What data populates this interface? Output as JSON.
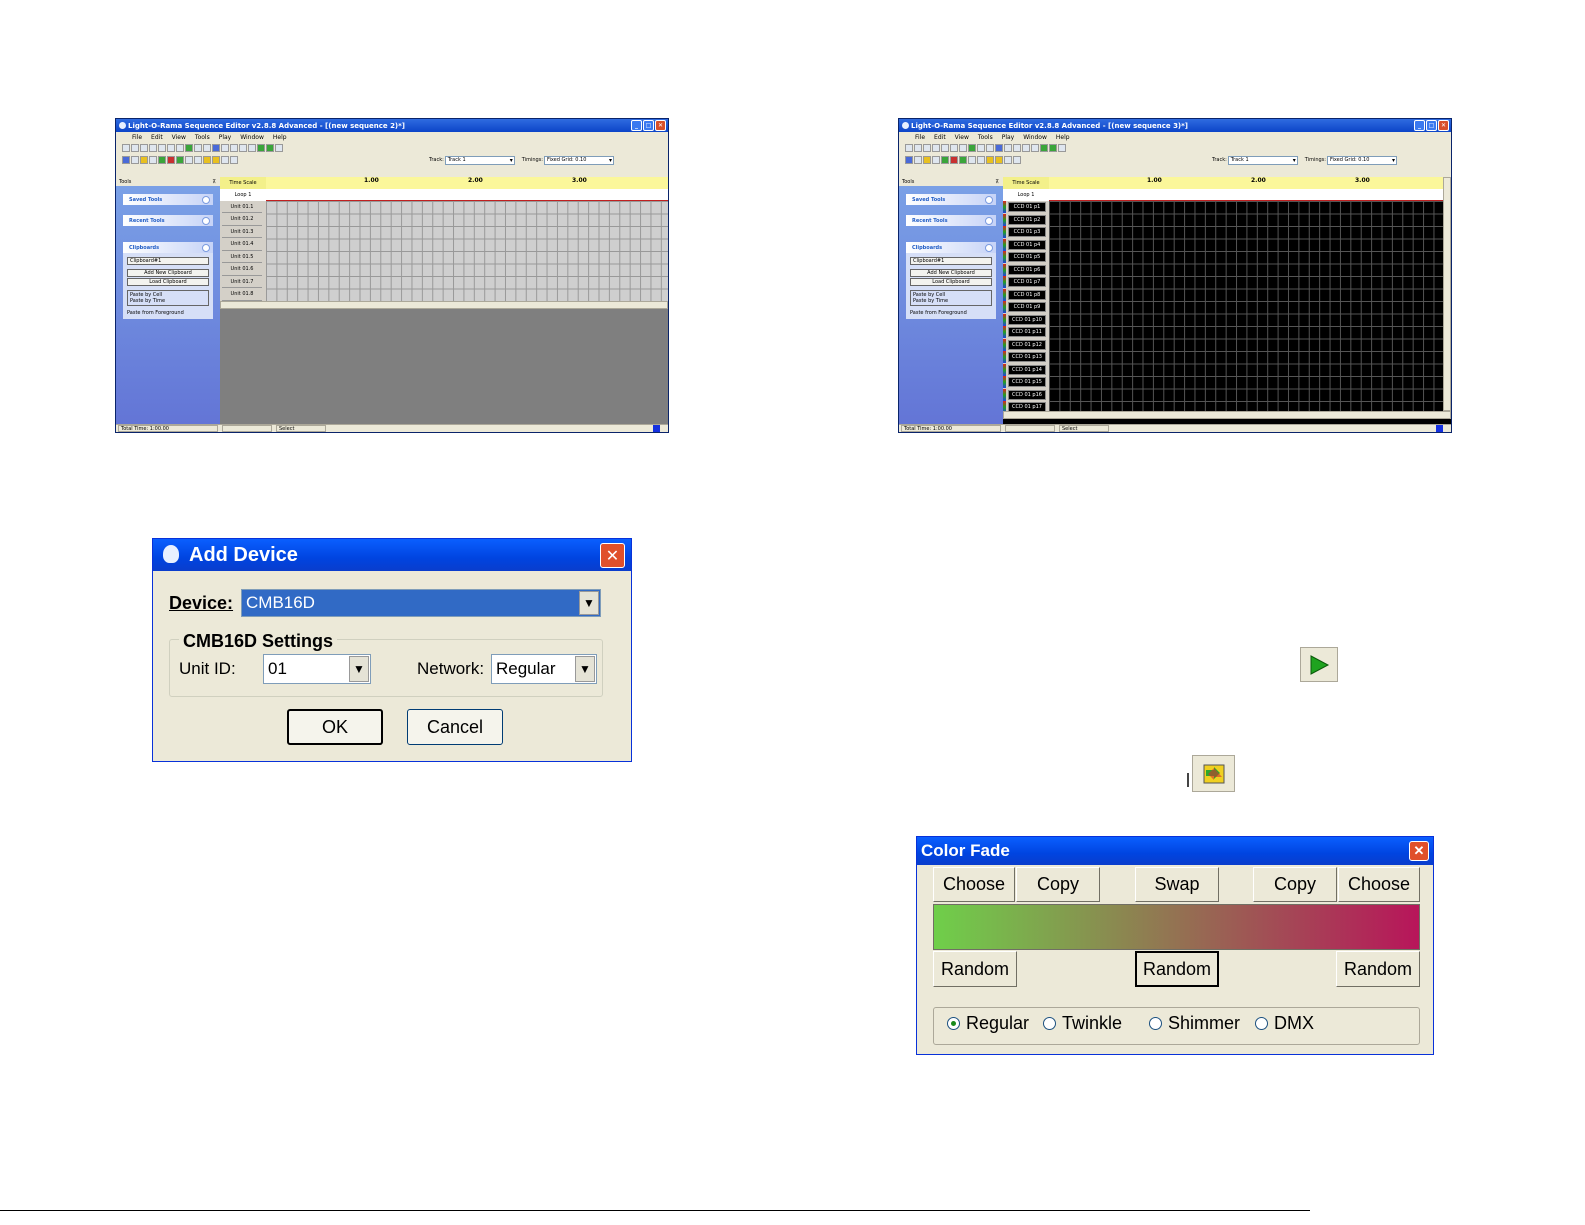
{
  "window1": {
    "title": "Light-O-Rama Sequence Editor v2.8.8 Advanced - [(new sequence 2)*]",
    "menu": [
      "File",
      "Edit",
      "View",
      "Tools",
      "Play",
      "Window",
      "Help"
    ],
    "track_label": "Track:",
    "track_value": "Track 1",
    "timings_label": "Timings:",
    "timings_value": "Fixed Grid: 0.10",
    "tools_label": "Tools",
    "panes": {
      "saved_tools": "Saved Tools",
      "recent_tools": "Recent Tools",
      "clipboards": "Clipboards"
    },
    "clipboard_value": "Clipboard#1",
    "add_clipboard": "Add New Clipboard",
    "load_clipboard": "Load Clipboard",
    "paste_by_cell": "Paste by Cell",
    "paste_by_time": "Paste by Time",
    "paste_from_foreground": "Paste from Foreground",
    "time_scale": "Time Scale",
    "ticks": [
      "1.00",
      "2.00",
      "3.00"
    ],
    "loop": "Loop 1",
    "rows": [
      "Unit 01.1",
      "Unit 01.2",
      "Unit 01.3",
      "Unit 01.4",
      "Unit 01.5",
      "Unit 01.6",
      "Unit 01.7",
      "Unit 01.8"
    ],
    "status_total": "Total Time: 1:00.00",
    "status_mode": "Select"
  },
  "window2": {
    "title": "Light-O-Rama Sequence Editor v2.8.8 Advanced - [(new sequence 3)*]",
    "menu": [
      "File",
      "Edit",
      "View",
      "Tools",
      "Play",
      "Window",
      "Help"
    ],
    "track_label": "Track:",
    "track_value": "Track 1",
    "timings_label": "Timings:",
    "timings_value": "Fixed Grid: 0.10",
    "tools_label": "Tools",
    "panes": {
      "saved_tools": "Saved Tools",
      "recent_tools": "Recent Tools",
      "clipboards": "Clipboards"
    },
    "clipboard_value": "Clipboard#1",
    "add_clipboard": "Add New Clipboard",
    "load_clipboard": "Load Clipboard",
    "paste_by_cell": "Paste by Cell",
    "paste_by_time": "Paste by Time",
    "paste_from_foreground": "Paste from Foreground",
    "time_scale": "Time Scale",
    "ticks": [
      "1.00",
      "2.00",
      "3.00"
    ],
    "loop": "Loop 1",
    "rows": [
      "CCD 01 p1",
      "CCD 01 p2",
      "CCD 01 p3",
      "CCD 01 p4",
      "CCD 01 p5",
      "CCD 01 p6",
      "CCD 01 p7",
      "CCD 01 p8",
      "CCD 01 p9",
      "CCD 01 p10",
      "CCD 01 p11",
      "CCD 01 p12",
      "CCD 01 p13",
      "CCD 01 p14",
      "CCD 01 p15",
      "CCD 01 p16",
      "CCD 01 p17"
    ],
    "status_total": "Total Time: 1:00.00",
    "status_mode": "Select"
  },
  "add_device": {
    "title": "Add Device",
    "device_label": "Device:",
    "device_value": "CMB16D",
    "group_label": "CMB16D Settings",
    "unit_label": "Unit ID:",
    "unit_value": "01",
    "network_label": "Network:",
    "network_value": "Regular",
    "ok": "OK",
    "cancel": "Cancel"
  },
  "color_fade": {
    "title": "Color Fade",
    "buttons_top": [
      "Choose",
      "Copy",
      "Swap",
      "Copy",
      "Choose"
    ],
    "buttons_random": [
      "Random",
      "Random",
      "Random"
    ],
    "radios": [
      "Regular",
      "Twinkle",
      "Shimmer",
      "DMX"
    ],
    "selected": "Regular",
    "gradient_start": "#6fcf4a",
    "gradient_end": "#b8155a"
  }
}
